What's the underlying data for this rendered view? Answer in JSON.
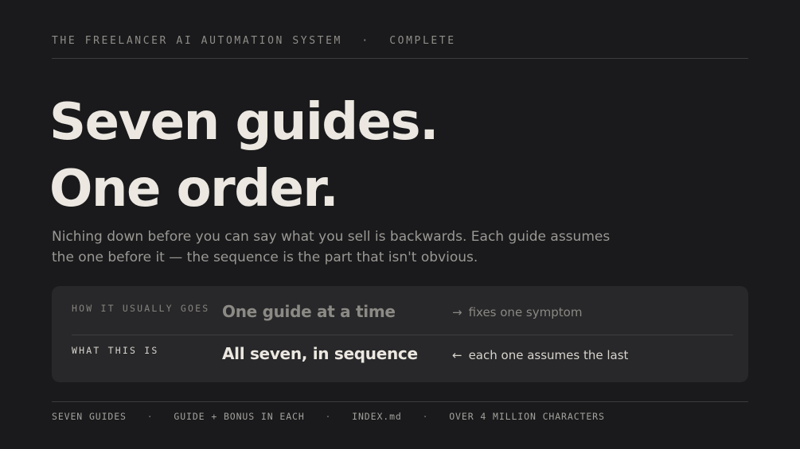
{
  "header": {
    "series_title": "THE FREELANCER AI AUTOMATION SYSTEM",
    "separator": "·",
    "status": "COMPLETE"
  },
  "hero": {
    "headline_line1": "Seven guides.",
    "headline_line2": "One order.",
    "subhead": "Niching down before you can say what you sell is backwards. Each guide assumes the one before it — the sequence is the part that isn't obvious."
  },
  "comparison": {
    "rows": [
      {
        "label": "HOW IT USUALLY GOES",
        "main": "One guide at a time",
        "arrow": "→",
        "note": "fixes one symptom"
      },
      {
        "label": "WHAT THIS IS",
        "main": "All seven, in sequence",
        "arrow": "←",
        "note": "each one assumes the last"
      }
    ]
  },
  "footer": {
    "separator": "·",
    "items": [
      "SEVEN GUIDES",
      "GUIDE + BONUS IN EACH",
      "INDEX.md",
      "OVER 4 MILLION CHARACTERS"
    ]
  },
  "colors": {
    "background": "#1a1a1c",
    "panel": "#28282a",
    "headline": "#ece8e1",
    "muted": "#9a9893"
  }
}
